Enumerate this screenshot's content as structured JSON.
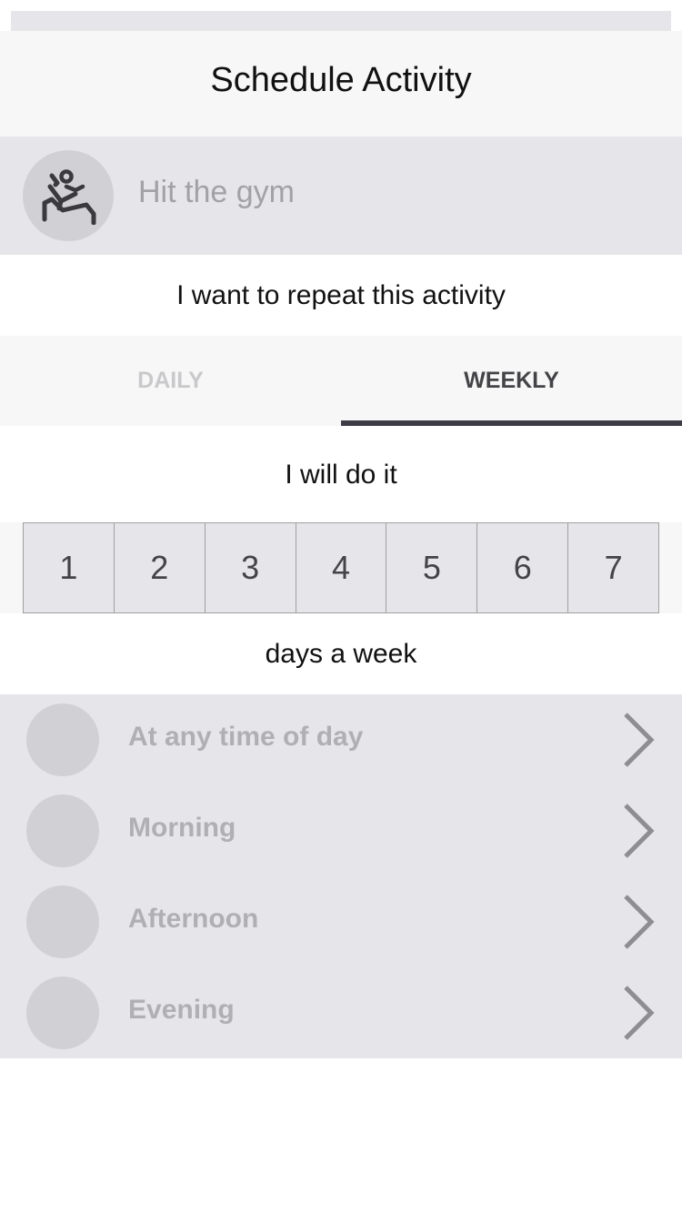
{
  "header": {
    "title": "Schedule Activity"
  },
  "activity": {
    "name": "Hit the gym",
    "icon": "gym-exercise-icon"
  },
  "repeat_label": "I want to repeat this activity",
  "tabs": [
    {
      "label": "DAILY",
      "selected": false
    },
    {
      "label": "WEEKLY",
      "selected": true
    }
  ],
  "will_do_label": "I will do it",
  "days": [
    "1",
    "2",
    "3",
    "4",
    "5",
    "6",
    "7"
  ],
  "days_suffix": "days a week",
  "times": [
    {
      "label": "At any time of day"
    },
    {
      "label": "Morning"
    },
    {
      "label": "Afternoon"
    },
    {
      "label": "Evening"
    }
  ],
  "colors": {
    "accent": "#3e3d47",
    "panel_gray": "#e6e6ea",
    "circle_gray": "#d1d1d5",
    "muted_text": "#b0b0b4"
  }
}
